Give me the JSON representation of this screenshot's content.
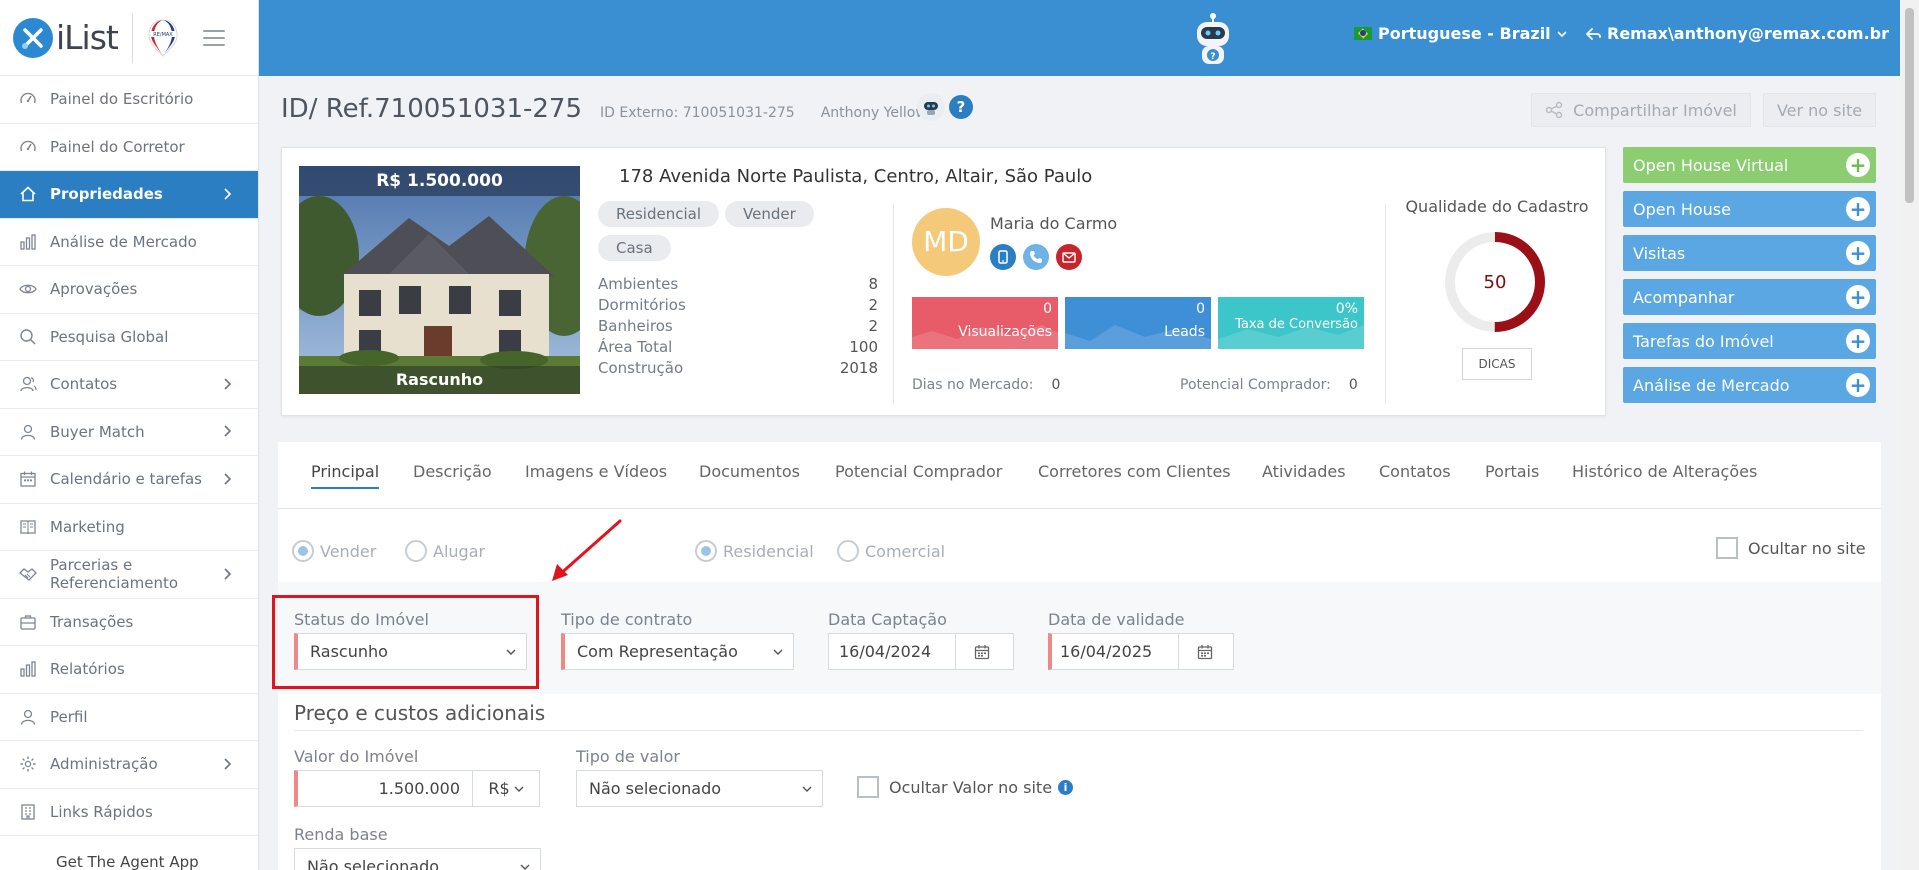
{
  "brand": {
    "name": "iList"
  },
  "sidebar": {
    "items": [
      {
        "label": "Painel do Escritório",
        "icon": "gauge-icon",
        "chevron": false
      },
      {
        "label": "Painel do Corretor",
        "icon": "gauge-icon",
        "chevron": false
      },
      {
        "label": "Propriedades",
        "icon": "home-icon",
        "chevron": true,
        "active": true
      },
      {
        "label": "Análise de Mercado",
        "icon": "bar-chart-icon",
        "chevron": false
      },
      {
        "label": "Aprovações",
        "icon": "eye-icon",
        "chevron": false
      },
      {
        "label": "Pesquisa Global",
        "icon": "search-icon",
        "chevron": false
      },
      {
        "label": "Contatos",
        "icon": "users-icon",
        "chevron": true
      },
      {
        "label": "Buyer Match",
        "icon": "user-icon",
        "chevron": true
      },
      {
        "label": "Calendário e tarefas",
        "icon": "calendar-icon",
        "chevron": true
      },
      {
        "label": "Marketing",
        "icon": "book-icon",
        "chevron": false
      },
      {
        "label": "Parcerias e Referenciamento",
        "icon": "handshake-icon",
        "chevron": true
      },
      {
        "label": "Transações",
        "icon": "briefcase-icon",
        "chevron": false
      },
      {
        "label": "Relatórios",
        "icon": "bar-chart-icon",
        "chevron": false
      },
      {
        "label": "Perfil",
        "icon": "user-icon",
        "chevron": false
      },
      {
        "label": "Administração",
        "icon": "gear-icon",
        "chevron": true
      },
      {
        "label": "Links Rápidos",
        "icon": "building-icon",
        "chevron": false
      }
    ],
    "get_app": "Get The Agent App"
  },
  "topbar": {
    "language": "Portuguese - Brazil",
    "user": "Remax\\anthony@remax.com.br",
    "color": "#3a8fd3"
  },
  "header": {
    "ref": "ID/ Ref.710051031-275",
    "external_id": "ID Externo: 710051031-275",
    "agent": "Anthony Yellow",
    "share_label": "Compartilhar Imóvel",
    "site_label": "Ver no site"
  },
  "property": {
    "price": "R$ 1.500.000",
    "status": "Rascunho",
    "address": "178 Avenida Norte Paulista, Centro, Altair, São Paulo",
    "chips": [
      "Residencial",
      "Vender",
      "Casa"
    ],
    "specs": [
      {
        "label": "Ambientes",
        "value": "8"
      },
      {
        "label": "Dormitórios",
        "value": "2"
      },
      {
        "label": "Banheiros",
        "value": "2"
      },
      {
        "label": "Área Total",
        "value": "100"
      },
      {
        "label": "Construção",
        "value": "2018"
      }
    ],
    "agent": {
      "initials": "MD",
      "name": "Maria do Carmo"
    },
    "stats": [
      {
        "value": "0",
        "label": "Visualizações",
        "color": "#e85b68"
      },
      {
        "value": "0",
        "label": "Leads",
        "color": "#3e8fd6"
      },
      {
        "value": "0%",
        "label": "Taxa de Conversão",
        "color": "#3cc6c9"
      }
    ],
    "days_label": "Dias no Mercado:",
    "days_value": "0",
    "buyer_label": "Potencial Comprador:",
    "buyer_value": "0",
    "quality_title": "Qualidade do Cadastro",
    "quality_value": "50",
    "quality_fraction": 0.5,
    "tips_label": "DICAS"
  },
  "actions": [
    {
      "label": "Open House Virtual",
      "style": "green"
    },
    {
      "label": "Open House",
      "style": "blue"
    },
    {
      "label": "Visitas",
      "style": "blue"
    },
    {
      "label": "Acompanhar",
      "style": "blue"
    },
    {
      "label": "Tarefas do Imóvel",
      "style": "blue"
    },
    {
      "label": "Análise de Mercado",
      "style": "blue"
    }
  ],
  "tabs": [
    "Principal",
    "Descrição",
    "Imagens e Vídeos",
    "Documentos",
    "Potencial Comprador",
    "Corretores com Clientes",
    "Atividades",
    "Contatos",
    "Portais",
    "Histórico de Alterações"
  ],
  "form": {
    "radios_type": [
      "Vender",
      "Alugar"
    ],
    "radios_kind": [
      "Residencial",
      "Comercial"
    ],
    "hide_site": "Ocultar no site",
    "status_label": "Status do Imóvel",
    "status_value": "Rascunho",
    "contract_label": "Tipo de contrato",
    "contract_value": "Com Representação",
    "capture_label": "Data Captação",
    "capture_value": "16/04/2024",
    "validity_label": "Data de validade",
    "validity_value": "16/04/2025",
    "price_section": "Preço e custos adicionais",
    "value_label": "Valor do Imóvel",
    "value_value": "1.500.000",
    "currency": "R$",
    "value_type_label": "Tipo de valor",
    "value_type_value": "Não selecionado",
    "hide_value": "Ocultar Valor no site",
    "base_label": "Renda base",
    "base_value": "Não selecionado"
  }
}
